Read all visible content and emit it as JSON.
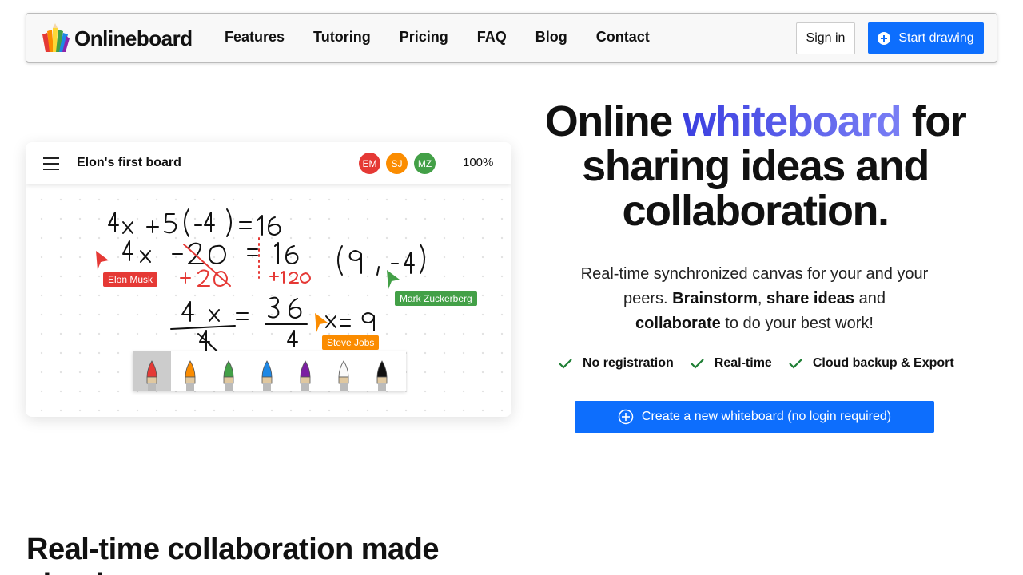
{
  "nav": {
    "brand": "Onlineboard",
    "items": [
      "Features",
      "Tutoring",
      "Pricing",
      "FAQ",
      "Blog",
      "Contact"
    ],
    "signin_label": "Sign in",
    "start_label": "Start drawing",
    "accent_color": "#0d6efd"
  },
  "board": {
    "title": "Elon's first board",
    "avatars": [
      {
        "initials": "EM",
        "color": "#e53935"
      },
      {
        "initials": "SJ",
        "color": "#fb8c00"
      },
      {
        "initials": "MZ",
        "color": "#43a047"
      }
    ],
    "zoom": "100%",
    "cursors": [
      {
        "name": "Elon Musk",
        "color": "#e53935"
      },
      {
        "name": "Mark Zuckerberg",
        "color": "#43a047"
      },
      {
        "name": "Steve Jobs",
        "color": "#fb8c00"
      }
    ],
    "markers": [
      "red",
      "orange",
      "green",
      "blue",
      "purple",
      "white",
      "black"
    ],
    "selected_marker": "red"
  },
  "hero": {
    "title_a": "Online ",
    "title_highlight": "whiteboard",
    "title_b": " for sharing ideas and collaboration.",
    "sub_1": "Real-time synchronized canvas for your and your peers. ",
    "sub_b1": "Brainstorm",
    "sub_2": ", ",
    "sub_b2": "share ideas",
    "sub_3": " and ",
    "sub_b3": "collaborate",
    "sub_4": " to do your best work!",
    "features": [
      "No registration",
      "Real-time",
      "Cloud backup & Export"
    ],
    "cta_label": "Create a new whiteboard (no login required)"
  },
  "section": {
    "title": "Real-time collaboration made simple"
  }
}
